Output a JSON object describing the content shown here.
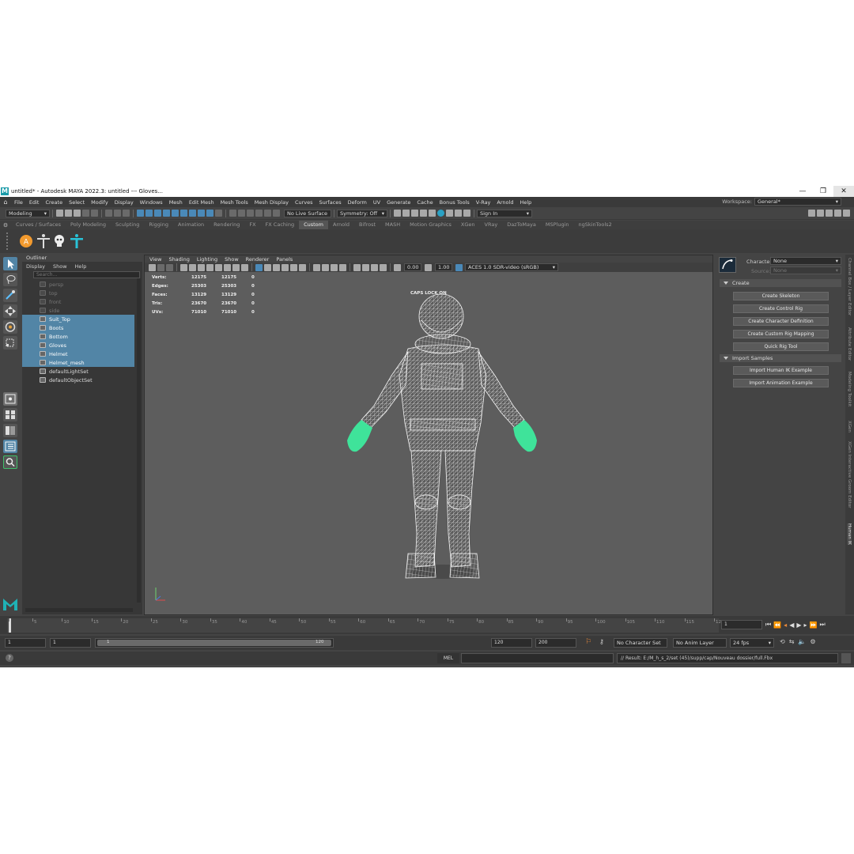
{
  "title": {
    "text": "untitled* - Autodesk MAYA 2022.3: untitled  ---  Gloves..."
  },
  "menubar": {
    "items": [
      "File",
      "Edit",
      "Create",
      "Select",
      "Modify",
      "Display",
      "Windows",
      "Mesh",
      "Edit Mesh",
      "Mesh Tools",
      "Mesh Display",
      "Curves",
      "Surfaces",
      "Deform",
      "UV",
      "Generate",
      "Cache",
      "Bonus Tools",
      "V-Ray",
      "Arnold",
      "Help"
    ],
    "workspace_label": "Workspace:",
    "workspace_value": "General*"
  },
  "statusline": {
    "mode": "Modeling",
    "live_surface": "No Live Surface",
    "symmetry": "Symmetry: Off",
    "sign_in": "Sign In"
  },
  "shelf": {
    "tabs": [
      "Curves / Surfaces",
      "Poly Modeling",
      "Sculpting",
      "Rigging",
      "Animation",
      "Rendering",
      "FX",
      "FX Caching",
      "Custom",
      "Arnold",
      "Bifrost",
      "MASH",
      "Motion Graphics",
      "XGen",
      "VRay",
      "DazToMaya",
      "MSPlugin",
      "ngSkinTools2"
    ],
    "active_tab": "Custom"
  },
  "outliner": {
    "title": "Outliner",
    "menu": [
      "Display",
      "Show",
      "Help"
    ],
    "search_placeholder": "Search...",
    "items": [
      {
        "label": "persp",
        "state": "dim"
      },
      {
        "label": "top",
        "state": "dim"
      },
      {
        "label": "front",
        "state": "dim"
      },
      {
        "label": "side",
        "state": "dim"
      },
      {
        "label": "Suit_Top",
        "state": "sel"
      },
      {
        "label": "Boots",
        "state": "sel"
      },
      {
        "label": "Bottom",
        "state": "sel"
      },
      {
        "label": "Gloves",
        "state": "sel"
      },
      {
        "label": "Helmet",
        "state": "sel"
      },
      {
        "label": "Helmet_mesh",
        "state": "sel"
      },
      {
        "label": "defaultLightSet",
        "state": "normal"
      },
      {
        "label": "defaultObjectSet",
        "state": "normal"
      }
    ]
  },
  "viewport": {
    "menu": [
      "View",
      "Shading",
      "Lighting",
      "Show",
      "Renderer",
      "Panels"
    ],
    "exposure": "0.00",
    "gamma": "1.00",
    "color_space": "ACES 1.0 SDR-video (sRGB)",
    "caps_lock": "CAPS LOCK ON",
    "hud": [
      {
        "label": "Verts:",
        "a": "12175",
        "b": "12175",
        "c": "0"
      },
      {
        "label": "Edges:",
        "a": "25303",
        "b": "25303",
        "c": "0"
      },
      {
        "label": "Faces:",
        "a": "13129",
        "b": "13129",
        "c": "0"
      },
      {
        "label": "Tris:",
        "a": "23670",
        "b": "23670",
        "c": "0"
      },
      {
        "label": "UVs:",
        "a": "71010",
        "b": "71010",
        "c": "0"
      }
    ],
    "wire_color": "#e8e8e8",
    "glove_color": "#3fe39a"
  },
  "humanik": {
    "character_label": "Character:",
    "character_value": "None",
    "source_label": "Source:",
    "source_value": "None",
    "create_section": "Create",
    "create_buttons": [
      "Create Skeleton",
      "Create Control Rig",
      "Create Character Definition",
      "Create Custom Rig Mapping",
      "Quick Rig Tool"
    ],
    "import_section": "Import Samples",
    "import_buttons": [
      "Import Human IK Example",
      "Import Animation Example"
    ],
    "side_tabs": [
      "Channel Box / Layer Editor",
      "Attribute Editor",
      "Modeling Toolkit",
      "XGen",
      "XGen Interactive Groom Editor",
      "Human IK"
    ]
  },
  "timeline": {
    "ticks": [
      "1",
      "5",
      "10",
      "15",
      "20",
      "25",
      "30",
      "35",
      "40",
      "45",
      "50",
      "55",
      "60",
      "65",
      "70",
      "75",
      "80",
      "85",
      "90",
      "95",
      "100",
      "105",
      "110",
      "115",
      "120"
    ],
    "current_frame": "1"
  },
  "range": {
    "start": "1",
    "playback_start": "1",
    "slider_start": "1",
    "slider_end": "120",
    "playback_end": "120",
    "end": "200",
    "character_set": "No Character Set",
    "anim_layer": "No Anim Layer",
    "fps": "24 fps"
  },
  "command": {
    "lang": "MEL",
    "result": "// Result: E:/M_h_s_2/set (45)/supp/cap/Nouveau dossier/full.Fbx"
  }
}
